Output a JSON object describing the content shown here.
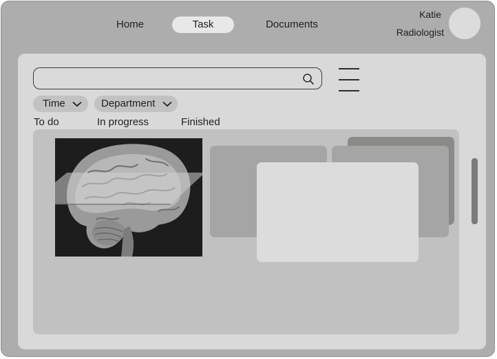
{
  "nav": {
    "home": "Home",
    "task": "Task",
    "documents": "Documents"
  },
  "user": {
    "name": "Katie",
    "role": "Radiologist"
  },
  "search": {
    "value": "",
    "placeholder": ""
  },
  "filters": {
    "time": "Time",
    "department": "Department"
  },
  "tabs": {
    "todo": "To do",
    "in_progress": "In progress",
    "finished": "Finished"
  },
  "icons": {
    "search": "search-icon",
    "menu": "hamburger-menu-icon",
    "dropdown": "chevron-down-icon"
  },
  "colors": {
    "frame_bg": "#adadad",
    "panel_bg": "#d9d9d9",
    "content_bg": "#c1c1c1",
    "active_nav_bg": "#e8e8e8"
  }
}
